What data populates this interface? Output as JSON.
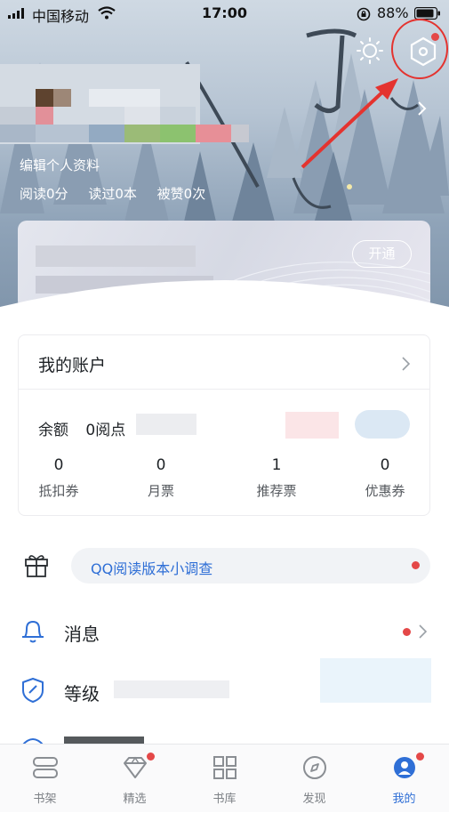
{
  "status_bar": {
    "carrier": "中国移动",
    "time": "17:00",
    "battery": "88%"
  },
  "profile": {
    "edit_link": "编辑个人资料",
    "stats": [
      "阅读0分",
      "读过0本",
      "被赞0次"
    ]
  },
  "vip_card": {
    "button_label": "开通"
  },
  "account": {
    "title": "我的账户",
    "balance_label": "余额",
    "balance_value": "0阅点",
    "items": [
      {
        "value": "0",
        "label": "抵扣券"
      },
      {
        "value": "0",
        "label": "月票"
      },
      {
        "value": "1",
        "label": "推荐票"
      },
      {
        "value": "0",
        "label": "优惠券"
      }
    ]
  },
  "survey": {
    "text": "QQ阅读版本小调查"
  },
  "menu": {
    "messages": "消息",
    "level": "等级"
  },
  "tabs": [
    {
      "label": "书架",
      "icon": "bookshelf-icon"
    },
    {
      "label": "精选",
      "icon": "diamond-icon",
      "badge": true
    },
    {
      "label": "书库",
      "icon": "grid-icon"
    },
    {
      "label": "发现",
      "icon": "compass-icon"
    },
    {
      "label": "我的",
      "icon": "profile-icon",
      "badge": true,
      "active": true
    }
  ],
  "colors": {
    "accent": "#2f6fd6",
    "badge_red": "#e44848",
    "annotation_red": "#e4332f"
  }
}
